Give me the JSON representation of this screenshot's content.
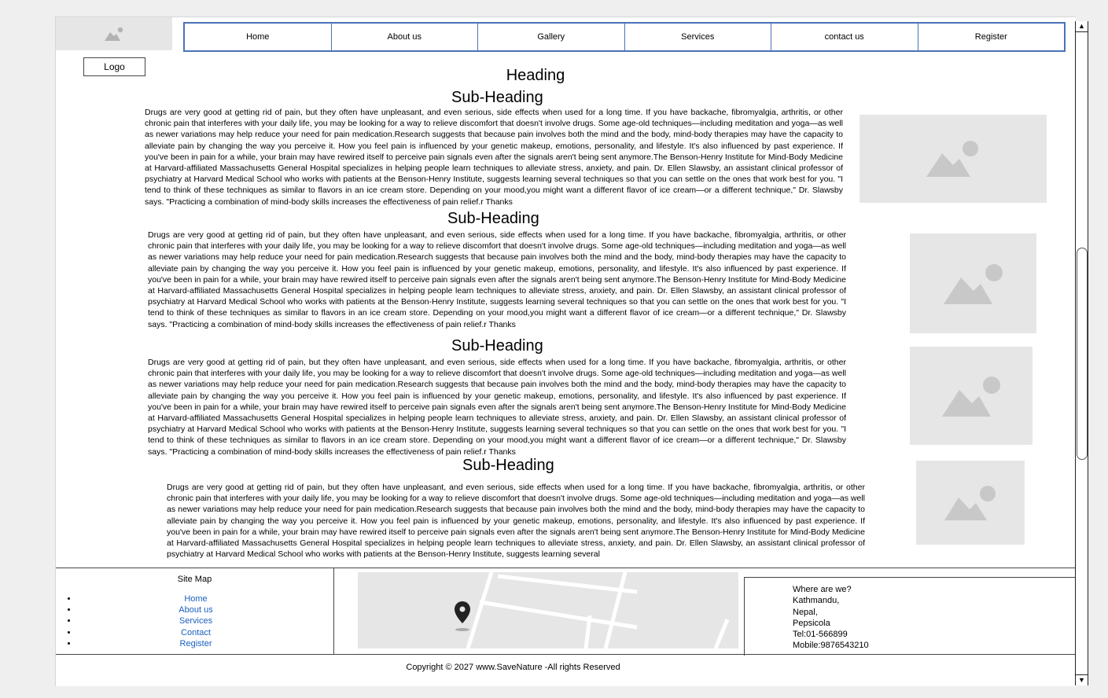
{
  "header": {
    "logo_label": "Logo",
    "nav": [
      "Home",
      "About us",
      "Gallery",
      "Services",
      "contact us",
      "Register"
    ]
  },
  "main": {
    "heading": "Heading",
    "sections": [
      {
        "subheading": "Sub-Heading",
        "text": "Drugs are very good at getting rid of pain, but they often have unpleasant, and even serious, side effects when used for a long time. If you have backache, fibromyalgia, arthritis, or other chronic pain that interferes with your daily life, you may be looking for a way to relieve discomfort that doesn't involve drugs. Some age-old techniques—including meditation and yoga—as well as newer variations may help reduce your need for pain medication.Research suggests that because pain involves both the mind and the body, mind-body therapies may have the capacity to alleviate pain by changing the way you perceive it. How you feel pain is influenced by your genetic makeup, emotions, personality, and lifestyle. It's also influenced by past experience. If you've been in pain for a while, your brain may have rewired itself to perceive pain signals even after the signals aren't being sent anymore.The Benson-Henry Institute for Mind-Body Medicine at Harvard-affiliated Massachusetts General Hospital specializes in helping people learn techniques to alleviate stress, anxiety, and pain. Dr. Ellen Slawsby, an assistant clinical professor of psychiatry at Harvard Medical School who works with patients at the Benson-Henry Institute, suggests learning several techniques so that you can settle on the ones that work best for you. \"I tend to think of these techniques as similar to flavors in an ice cream store. Depending on your mood,you might want a different flavor of ice cream—or a different technique,\" Dr. Slawsby says. \"Practicing a combination of mind-body skills increases the effectiveness of pain relief.r Thanks"
      },
      {
        "subheading": "Sub-Heading",
        "text": "Drugs are very good at getting rid of pain, but they often have unpleasant, and even serious, side effects when used for a long time. If you have backache, fibromyalgia, arthritis, or other chronic pain that interferes with your daily life, you may be looking for a way to relieve discomfort that doesn't involve drugs. Some age-old techniques—including meditation and yoga—as well as newer variations may help reduce your need for pain medication.Research suggests that because pain involves both the mind and the body, mind-body therapies may have the capacity to alleviate pain by changing the way you perceive it. How you feel pain is influenced by your genetic makeup, emotions, personality, and lifestyle. It's also influenced by past experience. If you've been in pain for a while, your brain may have rewired itself to perceive pain signals even after the signals aren't being sent anymore.The Benson-Henry Institute for Mind-Body Medicine at Harvard-affiliated Massachusetts General Hospital specializes in helping people learn techniques to alleviate stress, anxiety, and pain. Dr. Ellen Slawsby, an assistant clinical professor of psychiatry at Harvard Medical School who works with patients at the Benson-Henry Institute, suggests learning several techniques so that you can settle on the ones that work best for you. \"I tend to think of these techniques as similar to flavors in an ice cream store. Depending on your mood,you might want a different flavor of ice cream—or a different technique,\" Dr. Slawsby says. \"Practicing a combination of mind-body skills increases the effectiveness of pain relief.r Thanks"
      },
      {
        "subheading": "Sub-Heading",
        "text": "Drugs are very good at getting rid of pain, but they often have unpleasant, and even serious, side effects when used for a long time. If you have backache, fibromyalgia, arthritis, or other chronic pain that interferes with your daily life, you may be looking for a way to relieve discomfort that doesn't involve drugs. Some age-old techniques—including meditation and yoga—as well as newer variations may help reduce your need for pain medication.Research suggests that because pain involves both the mind and the body, mind-body therapies may have the capacity to alleviate pain by changing the way you perceive it. How you feel pain is influenced by your genetic makeup, emotions, personality, and lifestyle. It's also influenced by past experience. If you've been in pain for a while, your brain may have rewired itself to perceive pain signals even after the signals aren't being sent anymore.The Benson-Henry Institute for Mind-Body Medicine at Harvard-affiliated Massachusetts General Hospital specializes in helping people learn techniques to alleviate stress, anxiety, and pain. Dr. Ellen Slawsby, an assistant clinical professor of psychiatry at Harvard Medical School who works with patients at the Benson-Henry Institute, suggests learning several techniques so that you can settle on the ones that work best for you. \"I tend to think of these techniques as similar to flavors in an ice cream store. Depending on your mood,you might want a different flavor of ice cream—or a different technique,\" Dr. Slawsby says. \"Practicing a combination of mind-body skills increases the effectiveness of pain relief.r Thanks"
      },
      {
        "subheading": "Sub-Heading",
        "text": "Drugs are very good at getting rid of pain, but they often have unpleasant, and even serious, side effects when used for a long time. If you have backache, fibromyalgia, arthritis, or other chronic pain that interferes with your daily life, you may be looking for a way to relieve discomfort that doesn't involve drugs. Some age-old techniques—including meditation and yoga—as well as newer variations may help reduce your need for pain medication.Research suggests that because pain involves both the mind and the body, mind-body therapies may have the capacity to alleviate pain by changing the way you perceive it. How you feel pain is influenced by your genetic makeup, emotions, personality, and lifestyle. It's also influenced by past experience. If you've been in pain for a while, your brain may have rewired itself to perceive pain signals even after the signals aren't being sent anymore.The Benson-Henry Institute for Mind-Body Medicine at Harvard-affiliated Massachusetts General Hospital specializes in helping people learn techniques to alleviate stress, anxiety, and pain. Dr. Ellen Slawsby, an assistant clinical professor of psychiatry at Harvard Medical School who works with patients at the Benson-Henry Institute, suggests learning several"
      }
    ]
  },
  "footer": {
    "sitemap_title": "Site Map",
    "sitemap_links": [
      "Home",
      "About us",
      "Services",
      "Contact",
      "Register"
    ],
    "address": [
      "Where are we?",
      "Kathmandu,",
      "Nepal,",
      "Pepsicola",
      "Tel:01-566899",
      "Mobile:9876543210"
    ],
    "copyright": "Copyright © 2027 www.SaveNature -All rights Reserved"
  },
  "colors": {
    "nav_border": "#4a72b8",
    "link": "#1a5fbf",
    "placeholder": "#e6e6e6"
  }
}
